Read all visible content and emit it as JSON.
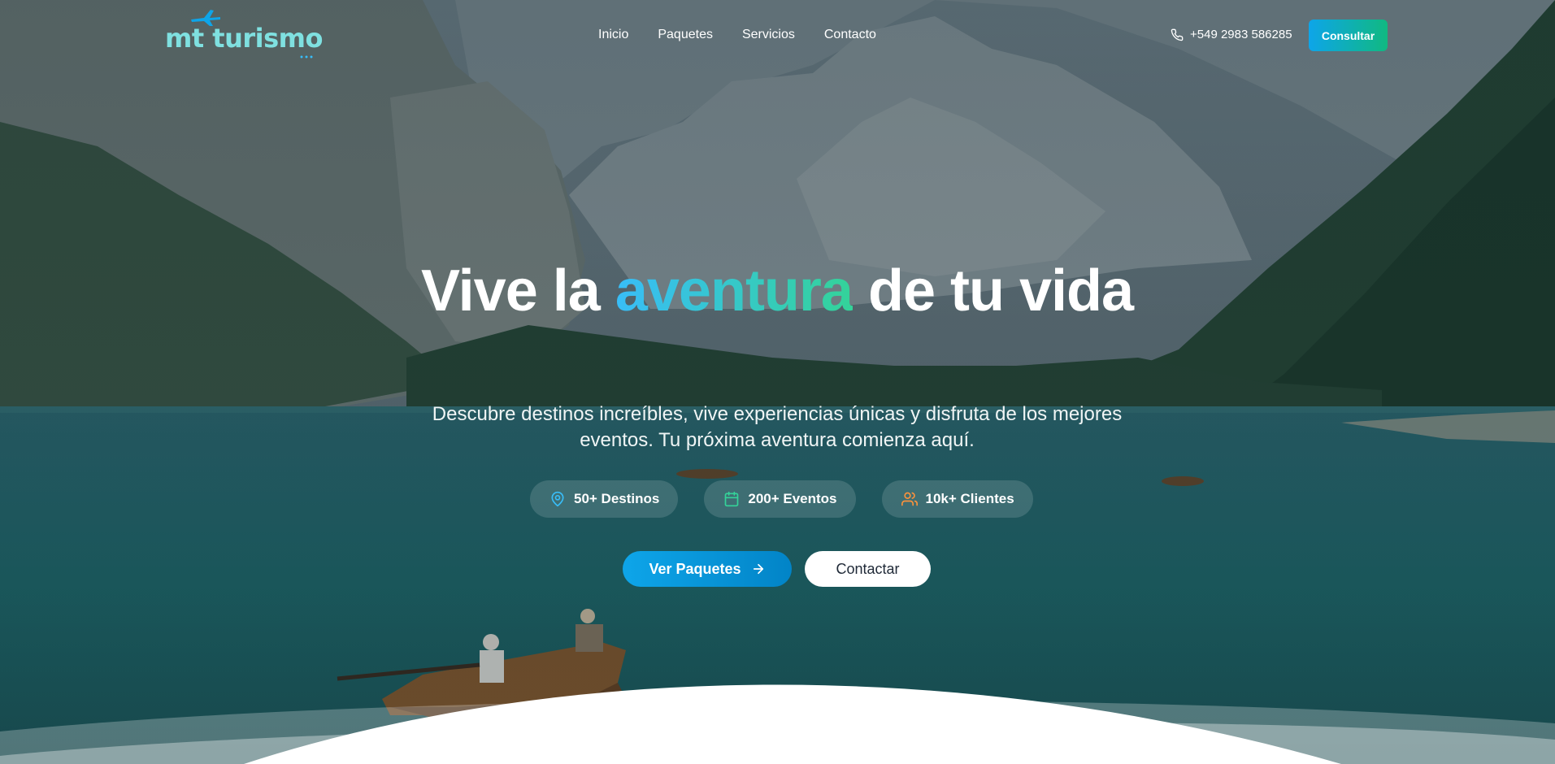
{
  "brand": {
    "name": "mt turismo",
    "logo_icon": "plane-icon",
    "color": "#7fe0e0"
  },
  "nav": {
    "items": [
      {
        "label": "Inicio"
      },
      {
        "label": "Paquetes"
      },
      {
        "label": "Servicios"
      },
      {
        "label": "Contacto"
      }
    ],
    "phone": "+549 2983 586285",
    "phone_icon": "phone-icon",
    "cta_label": "Consultar"
  },
  "hero": {
    "title_before": "Vive la ",
    "title_accent": "aventura",
    "title_after": " de tu vida",
    "subtitle": "Descubre destinos increíbles, vive experiencias únicas y disfruta de los mejores eventos. Tu próxima aventura comienza aquí.",
    "stats": [
      {
        "label": "50+ Destinos",
        "icon": "map-pin-icon",
        "color": "#38bdf8"
      },
      {
        "label": "200+ Eventos",
        "icon": "calendar-icon",
        "color": "#34d399"
      },
      {
        "label": "10k+ Clientes",
        "icon": "users-icon",
        "color": "#fb923c"
      }
    ],
    "primary_cta": "Ver Paquetes",
    "secondary_cta": "Contactar"
  },
  "colors": {
    "accent_start": "#0ea5e9",
    "accent_end": "#10b981"
  }
}
